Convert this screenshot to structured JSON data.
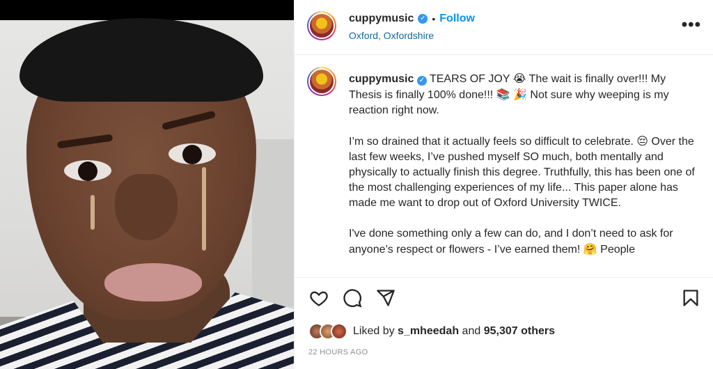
{
  "post": {
    "username": "cuppymusic",
    "follow_label": "Follow",
    "separator": "•",
    "location": "Oxford, Oxfordshire",
    "more_label": "•••"
  },
  "caption": {
    "username": "cuppymusic",
    "line1": "TEARS OF JOY",
    "line1b": "The wait is finally over!!! My Thesis is finally 100% done!!!",
    "line1c": "Not sure why weeping is my reaction right now.",
    "para2a": "I’m so drained that it actually feels so difficult to celebrate.",
    "para2b": "Over the last few weeks, I’ve pushed myself SO much, both mentally and physically to actually finish this degree. Truthfully, this has been one of the most challenging experiences of my life... This paper alone has made me want to drop out of Oxford University TWICE.",
    "para3a": "I've done something only a few can do, and I don’t need to ask for anyone’s respect or flowers - I’ve earned them!",
    "para3b": "People"
  },
  "emoji": {
    "tears": "😭",
    "books": "📚",
    "party": "🎉",
    "tired": "😔",
    "hug": "🤗"
  },
  "likes": {
    "prefix": "Liked by",
    "liker": "s_mheedah",
    "connector": "and",
    "count": "95,307 others"
  },
  "timestamp": "22 HOURS AGO",
  "icons": {
    "like": "heart-icon",
    "comment": "comment-icon",
    "share": "share-icon",
    "save": "bookmark-icon"
  },
  "colors": {
    "accent": "#0095f6",
    "verified": "#3897f0",
    "location": "#0f6b9b",
    "muted": "#8e8e8e"
  }
}
